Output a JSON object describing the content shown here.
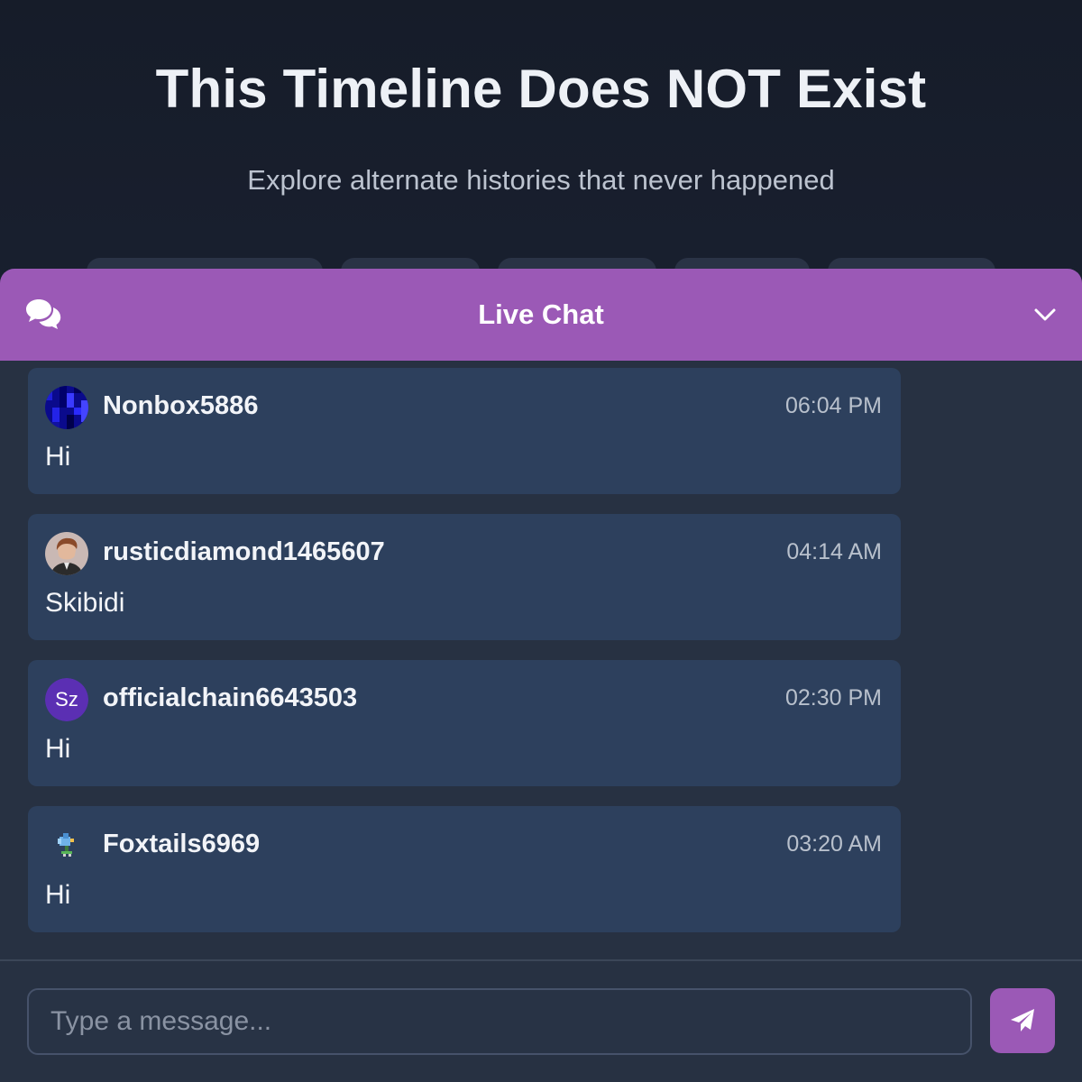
{
  "hero": {
    "title": "This Timeline Does NOT Exist",
    "subtitle": "Explore alternate histories that never happened"
  },
  "chat": {
    "title": "Live Chat",
    "header_icon": "chat-bubbles-icon",
    "collapse_icon": "chevron-down-icon",
    "accent_color": "#9b59b6",
    "messages": [
      {
        "username": "Nonbox5886",
        "time": "06:04 PM",
        "text": "Hi",
        "avatar": "pixel-pattern-avatar"
      },
      {
        "username": "rusticdiamond1465607",
        "time": "04:14 AM",
        "text": "Skibidi",
        "avatar": "photo-avatar"
      },
      {
        "username": "officialchain6643503",
        "time": "02:30 PM",
        "text": "Hi",
        "avatar_initials": "Sz"
      },
      {
        "username": "Foxtails6969",
        "time": "03:20 AM",
        "text": "Hi",
        "avatar": "bird-sprite-avatar"
      }
    ],
    "input": {
      "placeholder": "Type a message...",
      "value": ""
    },
    "send_icon": "paper-plane-icon"
  }
}
